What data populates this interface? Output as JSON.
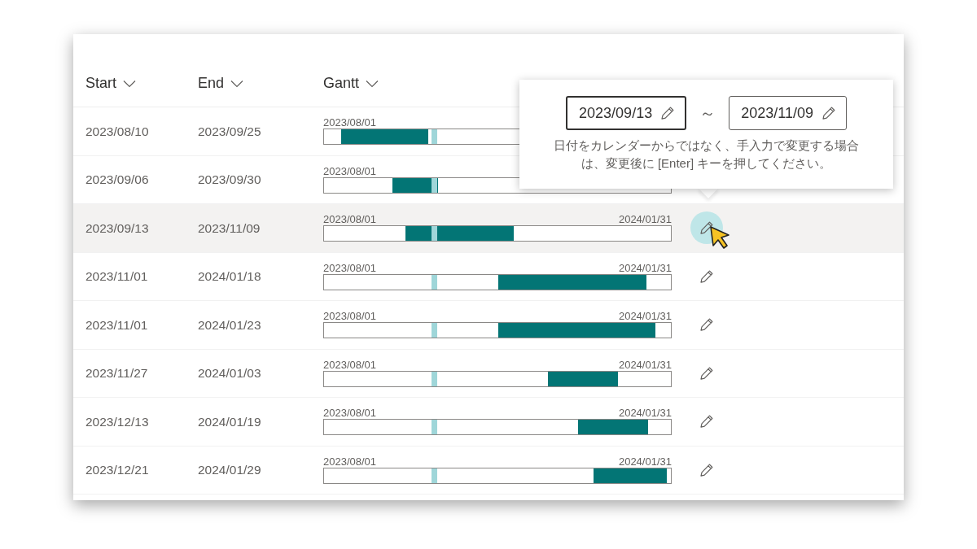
{
  "columns": [
    {
      "label": "Start"
    },
    {
      "label": "End"
    },
    {
      "label": "Gantt"
    }
  ],
  "today": {
    "level": 0.31
  },
  "rows": [
    {
      "start": "2023/08/10",
      "end": "2023/09/25",
      "range_start": "2023/08/01",
      "hovered": false
    },
    {
      "start": "2023/09/06",
      "end": "2023/09/30",
      "range_start": "2023/08/01",
      "hovered": false
    },
    {
      "start": "2023/09/13",
      "end": "2023/11/09",
      "range_start": "2023/08/01",
      "range_end": "2024/01/31",
      "hovered": true
    },
    {
      "start": "2023/11/01",
      "end": "2024/01/18",
      "range_start": "2023/08/01",
      "range_end": "2024/01/31",
      "hovered": false
    },
    {
      "start": "2023/11/01",
      "end": "2024/01/23",
      "range_start": "2023/08/01",
      "range_end": "2024/01/31",
      "hovered": false
    },
    {
      "start": "2023/11/27",
      "end": "2024/01/03",
      "range_start": "2023/08/01",
      "range_end": "2024/01/31",
      "hovered": false
    },
    {
      "start": "2023/12/13",
      "end": "2024/01/19",
      "range_start": "2023/08/01",
      "range_end": "2024/01/31",
      "hovered": false
    },
    {
      "start": "2023/12/21",
      "end": "2024/01/29",
      "range_start": "2023/08/01",
      "range_end": "2024/01/31",
      "hovered": false
    }
  ],
  "popover": {
    "fields": [
      {
        "value": "2023/09/13",
        "focused": true
      },
      {
        "value": "2023/11/09",
        "focused": false
      }
    ],
    "separator": "～",
    "help": "日付をカレンダーからではなく、手入力で変更する場合は、変更後に [Enter] キーを押してください。"
  }
}
